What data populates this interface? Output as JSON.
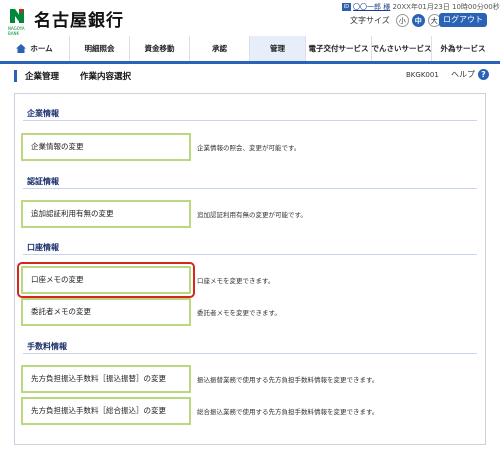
{
  "header": {
    "bank_name": "名古屋銀行",
    "user_name": "〇〇一郎 様",
    "datetime": "20XX年01月23日 10時00分00秒",
    "font_size_label": "文字サイズ",
    "font_sizes": [
      "小",
      "中",
      "大"
    ],
    "active_font_size": "中",
    "logout_label": "ログアウト"
  },
  "nav": {
    "items": [
      "ホーム",
      "明細照会",
      "資金移動",
      "承認",
      "管理",
      "電子交付サービス",
      "でんさいサービス",
      "外為サービス"
    ],
    "active": "管理"
  },
  "page": {
    "title": "企業管理",
    "subtitle": "作業内容選択",
    "screen_id": "BKGK001",
    "help_label": "ヘルプ"
  },
  "sections": [
    {
      "title": "企業情報",
      "items": [
        {
          "label": "企業情報の変更",
          "description": "企業情報の照会、変更が可能です。"
        }
      ]
    },
    {
      "title": "認証情報",
      "items": [
        {
          "label": "追加認証利用有無の変更",
          "description": "追加認証利用有無の変更が可能です。"
        }
      ]
    },
    {
      "title": "口座情報",
      "items": [
        {
          "label": "口座メモの変更",
          "description": "口座メモを変更できます。"
        },
        {
          "label": "委託者メモの変更",
          "description": "委託者メモを変更できます。"
        }
      ]
    },
    {
      "title": "手数料情報",
      "items": [
        {
          "label": "先方負担振込手数料［振込振替］の変更",
          "description": "振込振替業務で使用する先方負担手数料情報を変更できます。"
        },
        {
          "label": "先方負担振込手数料［総合振込］の変更",
          "description": "総合振込業務で使用する先方負担手数料情報を変更できます。"
        }
      ]
    }
  ],
  "colors": {
    "accent": "#2a63b6",
    "button_border": "#b9d880",
    "highlight": "#d7261e"
  }
}
